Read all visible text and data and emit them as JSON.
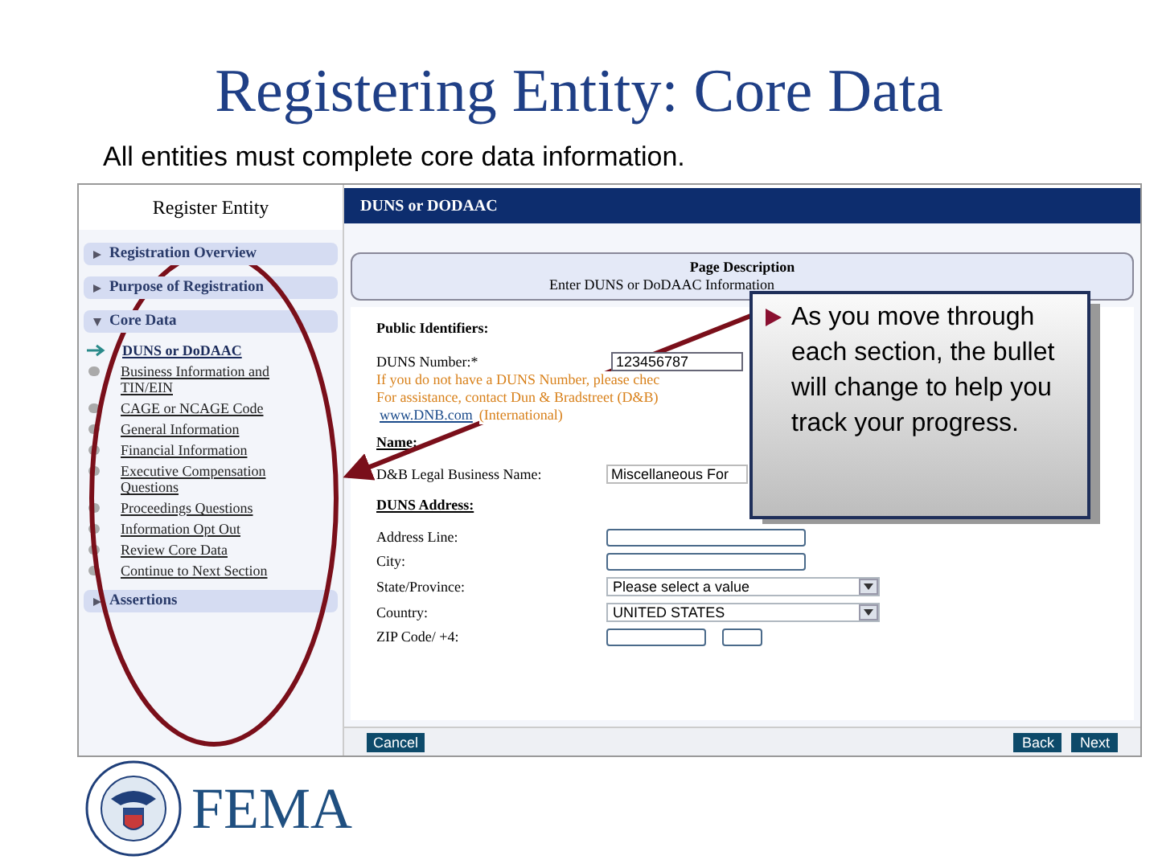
{
  "title": "Registering Entity: Core Data",
  "subtitle": "All entities must complete core data information.",
  "screenshot": {
    "sidebar": {
      "title": "Register Entity",
      "sections": [
        {
          "label": "Registration Overview",
          "expanded": false
        },
        {
          "label": "Purpose of Registration",
          "expanded": false
        },
        {
          "label": "Core Data",
          "expanded": true,
          "children": [
            {
              "label": "DUNS or DoDAAC",
              "current": true
            },
            {
              "label": "Business Information and TIN/EIN",
              "current": false
            },
            {
              "label": "CAGE or NCAGE Code",
              "current": false
            },
            {
              "label": "General Information",
              "current": false
            },
            {
              "label": "Financial Information",
              "current": false
            },
            {
              "label": "Executive Compensation Questions",
              "current": false
            },
            {
              "label": "Proceedings Questions",
              "current": false
            },
            {
              "label": "Information Opt Out",
              "current": false
            },
            {
              "label": "Review Core Data",
              "current": false
            },
            {
              "label": "Continue to Next Section",
              "current": false
            }
          ]
        },
        {
          "label": "Assertions",
          "expanded": false
        }
      ]
    },
    "header": "DUNS or DODAAC",
    "page_description": {
      "title": "Page Description",
      "text": "Enter DUNS or DoDAAC Information"
    },
    "public_identifiers_heading": "Public Identifiers:",
    "duns": {
      "label": "DUNS Number:*",
      "value": "123456787",
      "help": [
        "If you do not have a DUNS Number, please chec",
        "For assistance, contact Dun & Bradstreet (D&B)"
      ],
      "link": "www.DNB.com",
      "link_note": "(International)"
    },
    "name_heading": "Name:",
    "legal_name": {
      "label": "D&B Legal Business Name:",
      "value": "Miscellaneous For"
    },
    "address_heading": "DUNS Address:",
    "address_fields": [
      {
        "label": "Address Line:",
        "kind": "text"
      },
      {
        "label": "City:",
        "kind": "text"
      },
      {
        "label": "State/Province:",
        "kind": "select",
        "value": "Please select a value"
      },
      {
        "label": "Country:",
        "kind": "select",
        "value": "UNITED STATES"
      },
      {
        "label": "ZIP Code/ +4:",
        "kind": "zip"
      }
    ],
    "buttons": {
      "left": [
        "Cancel"
      ],
      "right": [
        "Back",
        "Next"
      ]
    }
  },
  "callout": {
    "text": "As you move through each section, the bullet will change to help you track your progress."
  },
  "logo": {
    "text": "FEMA"
  }
}
